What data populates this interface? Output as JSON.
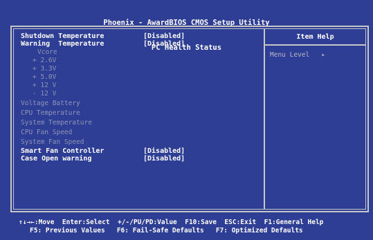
{
  "header": {
    "title_line1": "Phoenix - AwardBIOS CMOS Setup Utility",
    "title_line2": "PC Health Status"
  },
  "settings": [
    {
      "label": "Shutdown Temperature",
      "value": "[Disabled]"
    },
    {
      "label": "Warning  Temperature",
      "value": "[Disabled]"
    }
  ],
  "readings": [
    "Vcore",
    "+ 2.6V",
    "+ 3.3V",
    "+ 5.0V",
    "+ 12 V",
    "- 12 V",
    "Voltage Battery",
    "CPU Temperature",
    "System Temperature",
    "CPU Fan Speed",
    "System Fan Speed"
  ],
  "settings_bottom": [
    {
      "label": "Smart Fan Controller",
      "value": "[Disabled]"
    },
    {
      "label": "Case Open warning",
      "value": "[Disabled]"
    }
  ],
  "help_panel": {
    "title": "Item Help",
    "menu_level_label": "Menu Level",
    "menu_level_marker": "▸"
  },
  "footer": {
    "line1": "↑↓→←:Move  Enter:Select  +/-/PU/PD:Value  F10:Save  ESC:Exit  F1:General Help",
    "line2": "F5: Previous Values   F6: Fail-Safe Defaults   F7: Optimized Defaults"
  },
  "colors": {
    "background": "#2e3e94",
    "frame": "#c7c7c7",
    "text": "#ffffff",
    "dim_text": "#8d95b8"
  }
}
